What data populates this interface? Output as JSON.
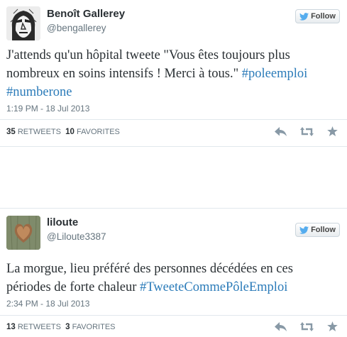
{
  "tweets": [
    {
      "name": "Benoît Gallerey",
      "handle": "@bengallerey",
      "follow_label": "Follow",
      "text_plain": "J'attends qu'un hôpital tweete \"Vous êtes toujours plus nombreux en soins intensifs ! Merci à tous.\" ",
      "hashtags": [
        "#poleemploi",
        "#numberone"
      ],
      "timestamp": "1:19 PM - 18 Jul 2013",
      "retweets_count": "35",
      "retweets_label": "RETWEETS",
      "favorites_count": "10",
      "favorites_label": "FAVORITES",
      "avatar_icon": "sketch-portrait-avatar"
    },
    {
      "name": "liloute",
      "handle": "@Liloute3387",
      "follow_label": "Follow",
      "text_plain": "La morgue, lieu préféré des personnes décédées en ces périodes de forte chaleur ",
      "hashtags": [
        "#TweeteCommePôleEmploi"
      ],
      "timestamp": "2:34 PM - 18 Jul 2013",
      "retweets_count": "13",
      "retweets_label": "RETWEETS",
      "favorites_count": "3",
      "favorites_label": "FAVORITES",
      "avatar_icon": "wooden-heart-avatar"
    }
  ],
  "colors": {
    "link": "#2b7bb9",
    "text": "#292f33",
    "muted": "#66757f",
    "twitter_bird": "#55acee"
  },
  "icons": [
    "twitter-bird-icon",
    "reply-icon",
    "retweet-icon",
    "favorite-star-icon"
  ]
}
